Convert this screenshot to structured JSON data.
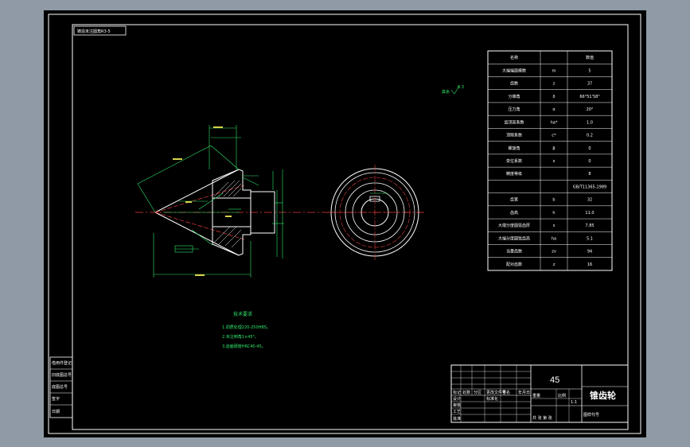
{
  "colors": {
    "background": "#000000",
    "app_bg": "#8f9aa6",
    "line_white": "#ffffff",
    "line_green": "#2ee66a",
    "line_red": "#e23b3b",
    "line_yellow": "#d8d44a"
  },
  "top_left_box": "铸造未注圆角R3-5",
  "roughness_note": "其余",
  "roughness_value": "6.3",
  "tech_title": "技术要求",
  "tech_notes": [
    "1.调质处理220-250HBS。",
    "2.未注倒角1×45°。",
    "3.齿面硬度HRC40-45。"
  ],
  "params": {
    "rows": [
      [
        "名称",
        "",
        "数值"
      ],
      [
        "大端端面模数",
        "m",
        "5"
      ],
      [
        "齿数",
        "z",
        "37"
      ],
      [
        "分锥角",
        "δ",
        "66°51'58\""
      ],
      [
        "压力角",
        "α",
        "20°"
      ],
      [
        "齿顶高系数",
        "ha*",
        "1.0"
      ],
      [
        "顶隙系数",
        "c*",
        "0.2"
      ],
      [
        "螺旋角",
        "β",
        "0"
      ],
      [
        "变位系数",
        "x",
        "0"
      ],
      [
        "精度等级",
        "",
        "8"
      ],
      [
        "",
        "",
        "GB/T11365-1989"
      ],
      [
        "齿宽",
        "b",
        "32"
      ],
      [
        "齿高",
        "h",
        "11.0"
      ],
      [
        "大端分度圆弦齿厚",
        "s",
        "7.85"
      ],
      [
        "大端分度圆弦齿高",
        "ha",
        "5.1"
      ],
      [
        "当量齿数",
        "zv",
        "94"
      ],
      [
        "配对齿数",
        "z",
        "16"
      ]
    ]
  },
  "title_block": {
    "material": "45",
    "part_name": "锥齿轮",
    "school": "图样代号",
    "scale_label": "比例",
    "scale": "1:1",
    "weight_label": "重量",
    "sheet_label": "共 张 第 张",
    "header_cells": [
      "标记",
      "处数",
      "分区",
      "更改文件号",
      "签名",
      "年月日"
    ],
    "role_cells": [
      "设计",
      "审核",
      "工艺",
      "批准",
      "标准化"
    ]
  },
  "left_strip": [
    "借用件登记",
    "旧底图总号",
    "底图总号",
    "签字",
    "日期"
  ]
}
